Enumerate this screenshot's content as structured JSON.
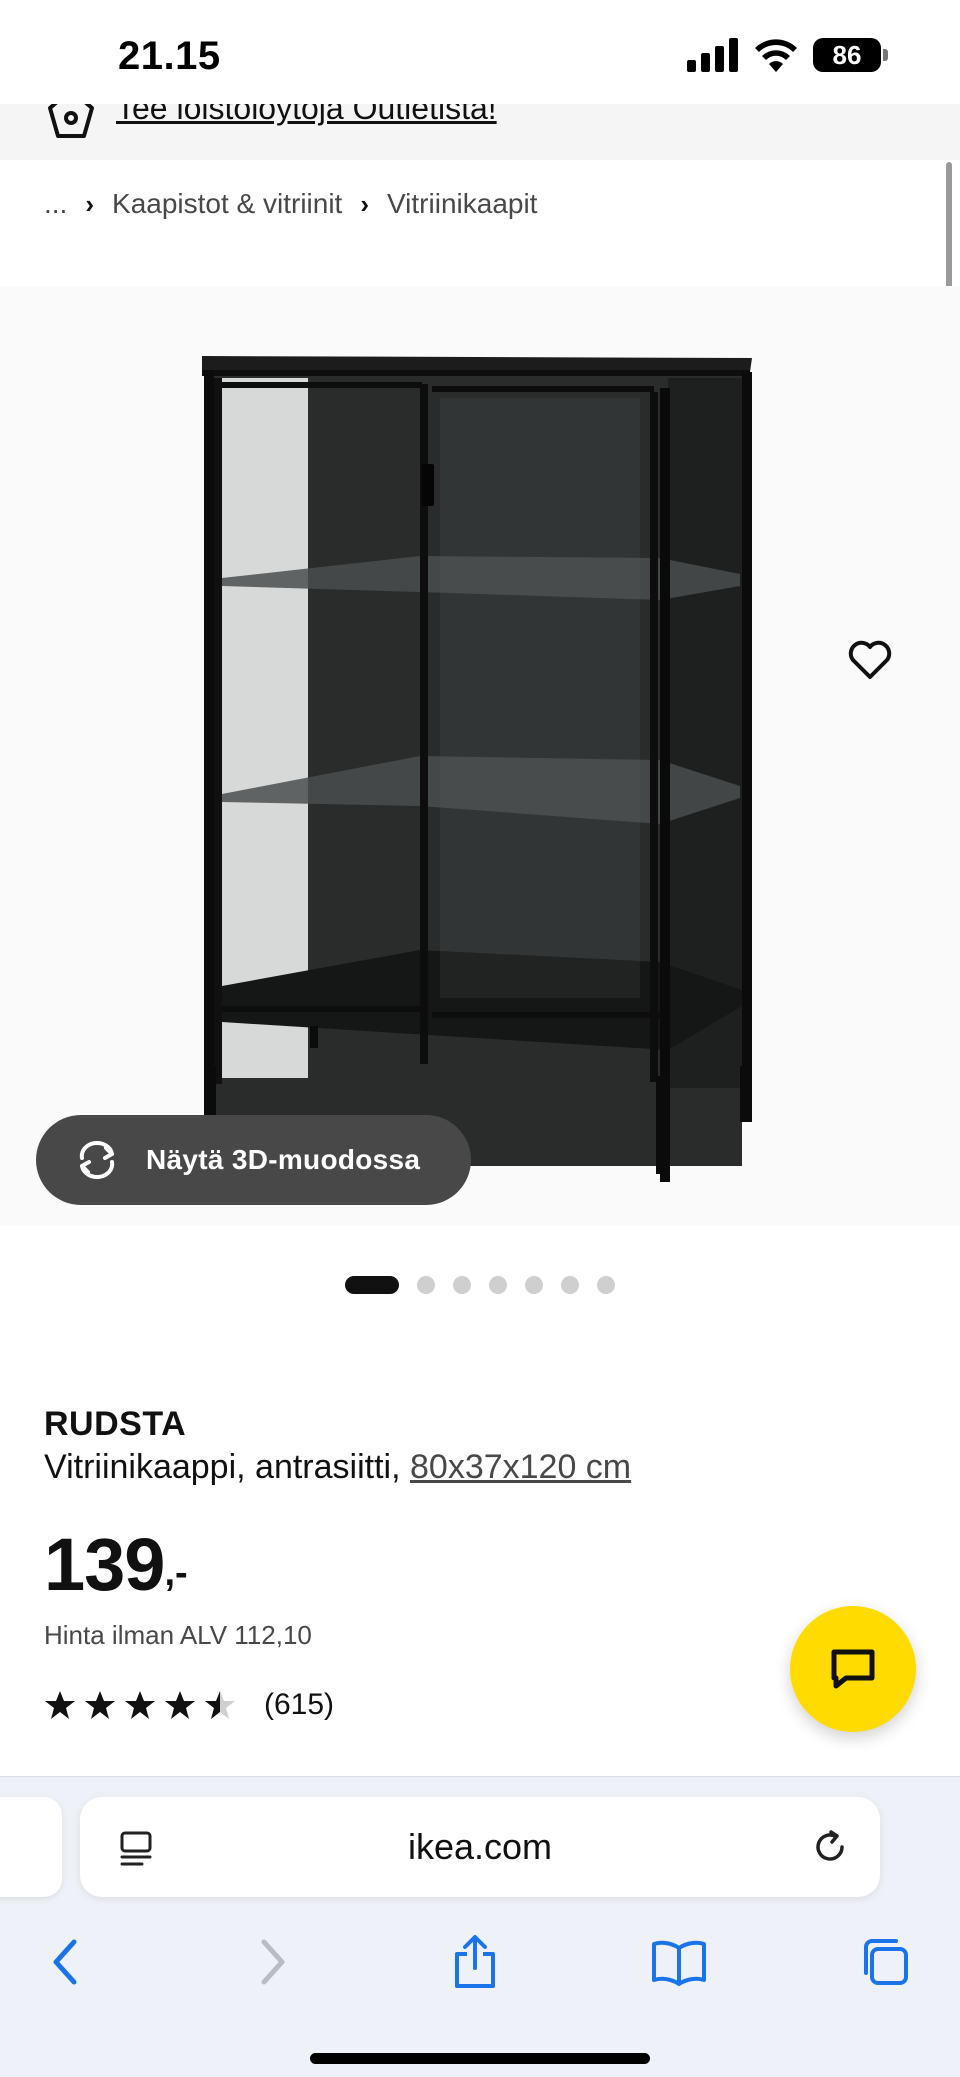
{
  "status_bar": {
    "time": "21.15",
    "battery": "86",
    "icons": [
      "cellular-signal-icon",
      "wifi-icon",
      "battery-icon"
    ]
  },
  "banner": {
    "text": "Tee loistolöytöjä Outletista!",
    "icon": "outlet-tag-icon"
  },
  "breadcrumb": {
    "items": [
      "...",
      "Kaapistot & vitriinit",
      "Vitriinikaapit"
    ],
    "separator_icon": "chevron-right-icon"
  },
  "gallery": {
    "image": "black glass-door display cabinet",
    "favourite_icon": "heart-icon",
    "view3d_label": "Näytä 3D-muodossa",
    "view3d_icon": "rotate-3d-icon",
    "dot_count": 7,
    "active_dot": 0
  },
  "product": {
    "name": "RUDSTA",
    "description": "Vitriinikaappi, antrasiitti,",
    "size": "80x37x120 cm",
    "price_integer": "139",
    "price_suffix": ",-",
    "price_note": "Hinta ilman ALV 112,10",
    "rating": 4.5,
    "rating_max": 5,
    "rating_count": "(615)"
  },
  "chat": {
    "icon": "chat-bubble-icon"
  },
  "safari": {
    "url": "ikea.com",
    "reader_icon": "page-menu-icon",
    "reload_icon": "reload-icon",
    "toolbar": [
      "back-icon",
      "forward-icon",
      "share-icon",
      "bookmarks-icon",
      "tabs-icon"
    ]
  },
  "colors": {
    "accent_yellow": "#ffdb00",
    "button_dark": "#484848",
    "ios_blue": "#1a73e8"
  }
}
